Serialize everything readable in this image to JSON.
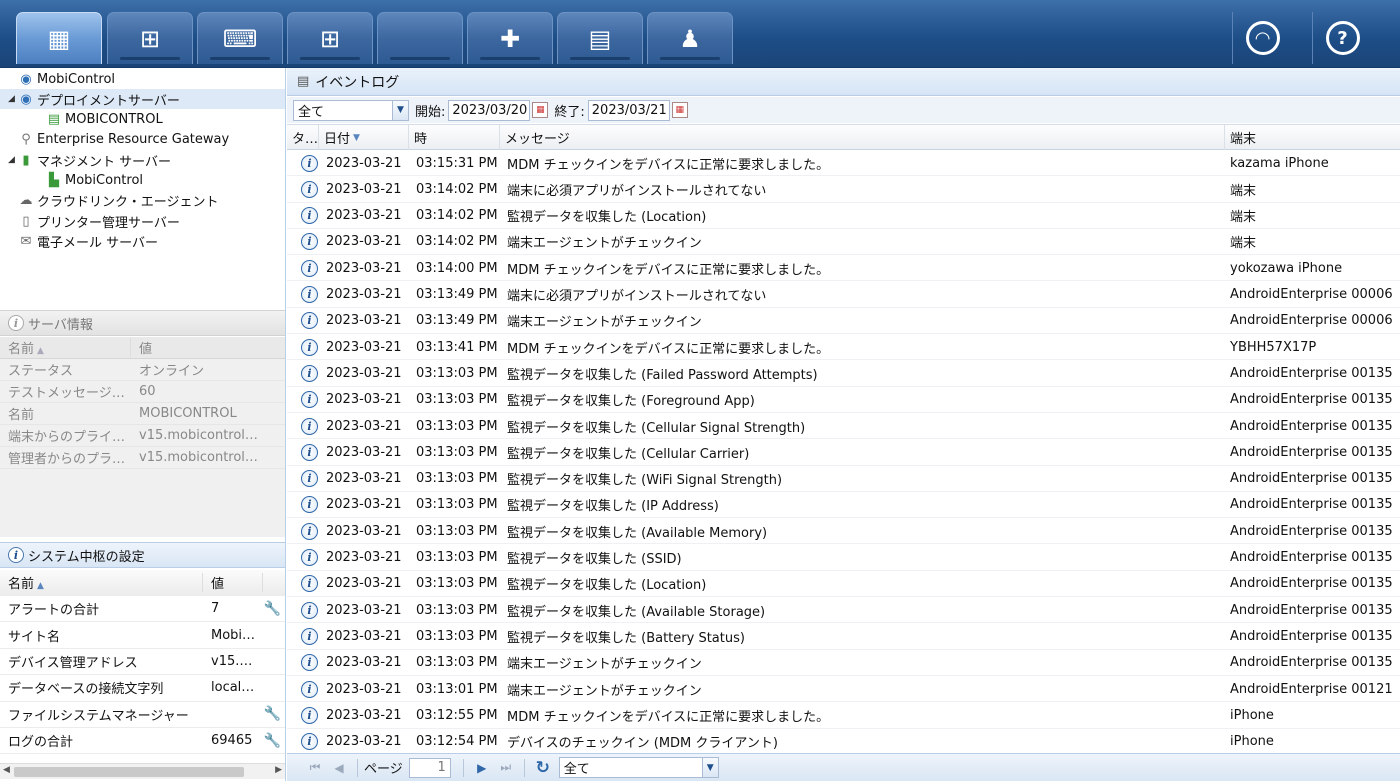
{
  "topbar": {
    "tabs": [
      {
        "id": "all",
        "icon": "grid-icon",
        "glyph": "▦"
      },
      {
        "id": "windows-mobile",
        "icon": "windows-mobile-icon",
        "glyph": "⊞"
      },
      {
        "id": "windows-desktop",
        "icon": "windows-desktop-icon",
        "glyph": "⌨"
      },
      {
        "id": "windows",
        "icon": "windows-logo-icon",
        "glyph": "⊞"
      },
      {
        "id": "apple",
        "icon": "apple-logo-icon",
        "glyph": ""
      },
      {
        "id": "android",
        "icon": "android-plus-icon",
        "glyph": "✚"
      },
      {
        "id": "handheld",
        "icon": "handheld-device-icon",
        "glyph": "▤"
      },
      {
        "id": "linux",
        "icon": "linux-penguin-icon",
        "glyph": "♟"
      }
    ],
    "support_glyph": "◠",
    "help_glyph": "?"
  },
  "tree": {
    "items": [
      {
        "label": "MobiControl",
        "indent": 0,
        "exp": "",
        "glyph": "◉",
        "color": "#2e6fb5",
        "icon": "mobicontrol-icon"
      },
      {
        "label": "デプロイメントサーバー",
        "indent": 0,
        "exp": "◢",
        "glyph": "◉",
        "color": "#2e6fb5",
        "icon": "deployment-server-icon",
        "selected": true
      },
      {
        "label": "MOBICONTROL",
        "indent": 2,
        "exp": "",
        "glyph": "▤",
        "color": "#3a9a3a",
        "icon": "server-icon"
      },
      {
        "label": "Enterprise Resource Gateway",
        "indent": 0,
        "exp": "",
        "glyph": "⚲",
        "color": "#777",
        "icon": "gateway-icon"
      },
      {
        "label": "マネジメント サーバー",
        "indent": 0,
        "exp": "◢",
        "glyph": "▮",
        "color": "#3a9a3a",
        "icon": "management-server-icon"
      },
      {
        "label": "MobiControl",
        "indent": 2,
        "exp": "",
        "glyph": "▙",
        "color": "#3a9a3a",
        "icon": "management-node-icon"
      },
      {
        "label": "クラウドリンク・エージェント",
        "indent": 0,
        "exp": "",
        "glyph": "☁",
        "color": "#666",
        "icon": "cloud-icon"
      },
      {
        "label": "プリンター管理サーバー",
        "indent": 0,
        "exp": "",
        "glyph": "▯",
        "color": "#666",
        "icon": "printer-server-icon"
      },
      {
        "label": "電子メール サーバー",
        "indent": 0,
        "exp": "",
        "glyph": "✉",
        "color": "#666",
        "icon": "mail-icon"
      }
    ]
  },
  "server_info": {
    "title": "サーバ情報",
    "col_name": "名前",
    "col_value": "値",
    "rows": [
      {
        "name": "ステータス",
        "value": "オンライン"
      },
      {
        "name": "テストメッセージ…",
        "value": "60"
      },
      {
        "name": "名前",
        "value": "MOBICONTROL"
      },
      {
        "name": "端末からのプライ…",
        "value": "v15.mobicontrolc…"
      },
      {
        "name": "管理者からのプラ…",
        "value": "v15.mobicontrolc…"
      }
    ]
  },
  "system_settings": {
    "title": "システム中枢の設定",
    "col_name": "名前",
    "col_value": "値",
    "rows": [
      {
        "name": "アラートの合計",
        "value": "7",
        "wrench": true
      },
      {
        "name": "サイト名",
        "value": "Mobi…",
        "wrench": false
      },
      {
        "name": "デバイス管理アドレス",
        "value": "v15.…",
        "wrench": false
      },
      {
        "name": "データベースの接続文字列",
        "value": "local…",
        "wrench": false
      },
      {
        "name": "ファイルシステムマネージャー",
        "value": "",
        "wrench": true
      },
      {
        "name": "ログの合計",
        "value": "69465",
        "wrench": true
      }
    ]
  },
  "eventlog": {
    "title": "イベントログ",
    "filter": "全て",
    "start_label": "開始:",
    "start_date": "2023/03/20",
    "end_label": "終了:",
    "end_date": "2023/03/21",
    "columns": {
      "type": "タ…",
      "date": "日付",
      "time": "時",
      "message": "メッセージ",
      "device": "端末"
    },
    "rows": [
      {
        "date": "2023-03-21",
        "time": "03:15:31 PM",
        "message": "MDM チェックインをデバイスに正常に要求しました。",
        "device": "kazama iPhone"
      },
      {
        "date": "2023-03-21",
        "time": "03:14:02 PM",
        "message": "端末に必須アプリがインストールされてない",
        "device": "端末"
      },
      {
        "date": "2023-03-21",
        "time": "03:14:02 PM",
        "message": "監視データを収集した (Location)",
        "device": "端末"
      },
      {
        "date": "2023-03-21",
        "time": "03:14:02 PM",
        "message": "端末エージェントがチェックイン",
        "device": "端末"
      },
      {
        "date": "2023-03-21",
        "time": "03:14:00 PM",
        "message": "MDM チェックインをデバイスに正常に要求しました。",
        "device": "yokozawa iPhone"
      },
      {
        "date": "2023-03-21",
        "time": "03:13:49 PM",
        "message": "端末に必須アプリがインストールされてない",
        "device": "AndroidEnterprise 00006"
      },
      {
        "date": "2023-03-21",
        "time": "03:13:49 PM",
        "message": "端末エージェントがチェックイン",
        "device": "AndroidEnterprise 00006"
      },
      {
        "date": "2023-03-21",
        "time": "03:13:41 PM",
        "message": "MDM チェックインをデバイスに正常に要求しました。",
        "device": "YBHH57X17P"
      },
      {
        "date": "2023-03-21",
        "time": "03:13:03 PM",
        "message": "監視データを収集した (Failed Password Attempts)",
        "device": "AndroidEnterprise 00135"
      },
      {
        "date": "2023-03-21",
        "time": "03:13:03 PM",
        "message": "監視データを収集した (Foreground App)",
        "device": "AndroidEnterprise 00135"
      },
      {
        "date": "2023-03-21",
        "time": "03:13:03 PM",
        "message": "監視データを収集した (Cellular Signal Strength)",
        "device": "AndroidEnterprise 00135"
      },
      {
        "date": "2023-03-21",
        "time": "03:13:03 PM",
        "message": "監視データを収集した (Cellular Carrier)",
        "device": "AndroidEnterprise 00135"
      },
      {
        "date": "2023-03-21",
        "time": "03:13:03 PM",
        "message": "監視データを収集した (WiFi Signal Strength)",
        "device": "AndroidEnterprise 00135"
      },
      {
        "date": "2023-03-21",
        "time": "03:13:03 PM",
        "message": "監視データを収集した (IP Address)",
        "device": "AndroidEnterprise 00135"
      },
      {
        "date": "2023-03-21",
        "time": "03:13:03 PM",
        "message": "監視データを収集した (Available Memory)",
        "device": "AndroidEnterprise 00135"
      },
      {
        "date": "2023-03-21",
        "time": "03:13:03 PM",
        "message": "監視データを収集した (SSID)",
        "device": "AndroidEnterprise 00135"
      },
      {
        "date": "2023-03-21",
        "time": "03:13:03 PM",
        "message": "監視データを収集した (Location)",
        "device": "AndroidEnterprise 00135"
      },
      {
        "date": "2023-03-21",
        "time": "03:13:03 PM",
        "message": "監視データを収集した (Available Storage)",
        "device": "AndroidEnterprise 00135"
      },
      {
        "date": "2023-03-21",
        "time": "03:13:03 PM",
        "message": "監視データを収集した (Battery Status)",
        "device": "AndroidEnterprise 00135"
      },
      {
        "date": "2023-03-21",
        "time": "03:13:03 PM",
        "message": "端末エージェントがチェックイン",
        "device": "AndroidEnterprise 00135"
      },
      {
        "date": "2023-03-21",
        "time": "03:13:01 PM",
        "message": "端末エージェントがチェックイン",
        "device": "AndroidEnterprise 00121"
      },
      {
        "date": "2023-03-21",
        "time": "03:12:55 PM",
        "message": "MDM チェックインをデバイスに正常に要求しました。",
        "device": "iPhone"
      },
      {
        "date": "2023-03-21",
        "time": "03:12:54 PM",
        "message": "デバイスのチェックイン (MDM クライアント)",
        "device": "iPhone"
      }
    ]
  },
  "pager": {
    "page_label": "ページ",
    "page_value": "1",
    "filter": "全て"
  }
}
